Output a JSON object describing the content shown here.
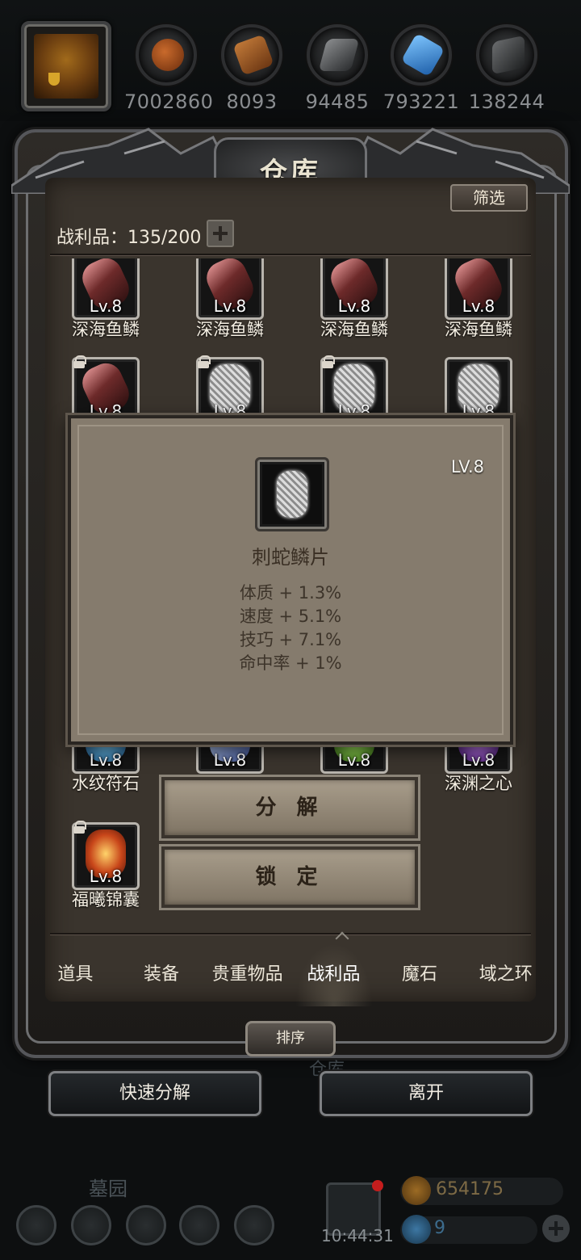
{
  "top_bar": {
    "resources": [
      {
        "icon": "meat-icon",
        "value": "7002860",
        "color": "#a7521f"
      },
      {
        "icon": "wood-icon",
        "value": "8093",
        "color": "#9c5f2b"
      },
      {
        "icon": "iron-icon",
        "value": "94485",
        "color": "#5b5d5f"
      },
      {
        "icon": "crystal-icon",
        "value": "793221",
        "color": "#2f7fd6"
      },
      {
        "icon": "stone-icon",
        "value": "138244",
        "color": "#4e5052"
      }
    ]
  },
  "panel": {
    "title": "仓库",
    "filter_label": "筛选",
    "capacity_label": "战利品：135/200"
  },
  "items": [
    {
      "name": "深海鱼鳞",
      "level": "Lv.8",
      "locked": false,
      "kind": "feather"
    },
    {
      "name": "深海鱼鳞",
      "level": "Lv.8",
      "locked": false,
      "kind": "feather"
    },
    {
      "name": "深海鱼鳞",
      "level": "Lv.8",
      "locked": false,
      "kind": "feather"
    },
    {
      "name": "深海鱼鳞",
      "level": "Lv.8",
      "locked": false,
      "kind": "feather"
    },
    {
      "name": "",
      "level": "Lv.8",
      "locked": true,
      "kind": "feather"
    },
    {
      "name": "",
      "level": "Lv.8",
      "locked": true,
      "kind": "scale"
    },
    {
      "name": "",
      "level": "Lv.8",
      "locked": true,
      "kind": "scale"
    },
    {
      "name": "",
      "level": "Lv.8",
      "locked": false,
      "kind": "scale"
    },
    {
      "name": "水纹符石",
      "level": "Lv.8",
      "locked": false,
      "kind": "water"
    },
    {
      "name": "",
      "level": "Lv.8",
      "locked": false,
      "kind": "blade"
    },
    {
      "name": "",
      "level": "Lv.8",
      "locked": false,
      "kind": "green"
    },
    {
      "name": "深渊之心",
      "level": "Lv.8",
      "locked": false,
      "kind": "purple"
    },
    {
      "name": "福曦锦囊",
      "level": "Lv.8",
      "locked": true,
      "kind": "fire"
    }
  ],
  "popup": {
    "level": "LV.8",
    "item_name": "刺蛇鳞片",
    "stats": [
      "体质 + 1.3%",
      "速度 + 5.1%",
      "技巧 + 7.1%",
      "命中率 + 1%"
    ]
  },
  "actions": {
    "decompose": "分 解",
    "lock": "锁 定"
  },
  "tabs": [
    {
      "label": "道具",
      "active": false
    },
    {
      "label": "装备",
      "active": false
    },
    {
      "label": "贵重物品",
      "active": false
    },
    {
      "label": "战利品",
      "active": true
    },
    {
      "label": "魔石",
      "active": false
    },
    {
      "label": "域之环",
      "active": false
    }
  ],
  "sort_label": "排序",
  "bottom": {
    "quick_decompose": "快速分解",
    "leave": "离开",
    "ghost_title": "仓库"
  },
  "hud": {
    "location": "墓园",
    "clock": "10:44:31",
    "gold": "654175",
    "gems": "9"
  }
}
